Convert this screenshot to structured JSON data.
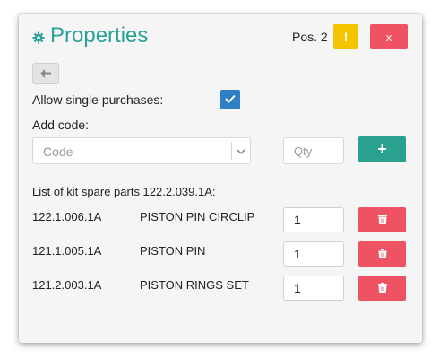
{
  "header": {
    "title": "Properties",
    "position_label": "Pos. 2",
    "warning_label": "!",
    "close_label": "x"
  },
  "form": {
    "allow_single_label": "Allow single purchases:",
    "allow_single_checked": true,
    "add_code_label": "Add code:",
    "code_placeholder": "Code",
    "qty_placeholder": "Qty",
    "add_button_label": "+"
  },
  "kit": {
    "title": "List of kit spare parts 122.2.039.1A:",
    "items": [
      {
        "code": "122.1.006.1A",
        "name": "PISTON PIN CIRCLIP",
        "qty": "1"
      },
      {
        "code": "121.1.005.1A",
        "name": "PISTON PIN",
        "qty": "1"
      },
      {
        "code": "121.2.003.1A",
        "name": "PISTON RINGS SET",
        "qty": "1"
      }
    ]
  },
  "colors": {
    "accent_teal": "#2aa18f",
    "danger_red": "#ef5363",
    "warning_yellow": "#f5c400",
    "checkbox_blue": "#2f7fc7"
  },
  "icons": {
    "title": "gear-icon",
    "back": "arrow-left-icon",
    "select": "chevron-down-icon",
    "checkbox": "check-icon",
    "delete": "trash-icon"
  }
}
